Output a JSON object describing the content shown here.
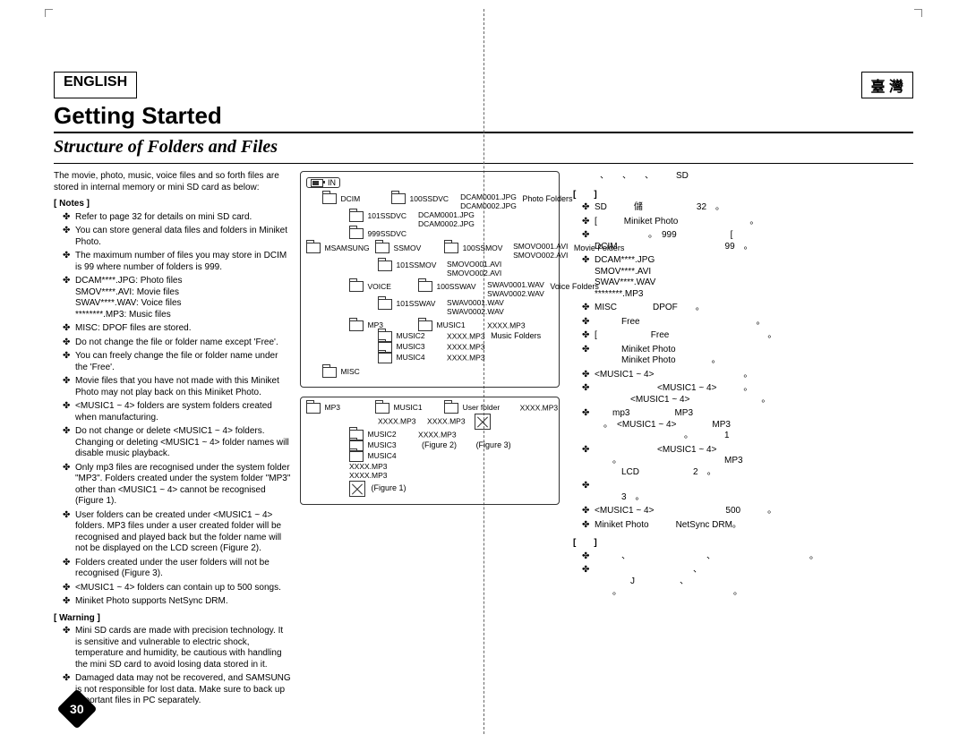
{
  "page_number": "30",
  "lang_left_label": "ENGLISH",
  "lang_right_label": "臺 灣",
  "title_en": "Getting Started",
  "subtitle_en": "Structure of Folders and Files",
  "intro_en": "The movie, photo, music, voice files and so forth files are stored in internal memory or mini SD card as below:",
  "notes_hdr": "Notes",
  "notes_en": [
    "Refer to page 32 for details on mini SD card.",
    "You can store general data files and folders in Miniket Photo.",
    "The maximum number of files you may store in DCIM is 99 where number of folders is 999.",
    "DCAM****.JPG: Photo files\nSMOV****.AVI: Movie files\nSWAV****.WAV: Voice files\n********.MP3: Music files",
    "MISC: DPOF files are stored.",
    "Do not change the file or folder name except 'Free'.",
    "You can freely change the file or folder name under the 'Free'.",
    "Movie files that you have not made with this Miniket Photo may not play back on this Miniket Photo.",
    "<MUSIC1 ~ 4> folders are system folders created when manufacturing.",
    "Do not change or delete <MUSIC1 ~ 4> folders. Changing or deleting <MUSIC1 ~ 4> folder names will disable music playback.",
    "Only mp3 files are recognised under the system folder \"MP3\". Folders created under the system folder \"MP3\" other than <MUSIC1 ~ 4> cannot be recognised (Figure 1).",
    "User folders can be created under <MUSIC1 ~ 4> folders. MP3 files under a user created folder will be recognised and played back but the folder name will not be displayed on the LCD screen (Figure 2).",
    "Folders created under the user folders will not be recognised (Figure 3).",
    "<MUSIC1 ~ 4> folders can contain up to 500 songs.",
    "Miniket Photo supports NetSync DRM."
  ],
  "warning_hdr": "Warning",
  "warnings_en": [
    "Mini SD cards are made with precision technology. It is sensitive and vulnerable to electric shock, temperature and humidity, be cautious with handling the mini SD card to avoid losing data stored in it.",
    "Damaged data may not be recovered, and SAMSUNG is not responsible for lost data. Make sure to back up important files in PC separately."
  ],
  "diagram": {
    "badge_text": "IN",
    "dcim": {
      "name": "DCIM",
      "subs": [
        "100SSDVC",
        "101SSDVC",
        "999SSDVC"
      ],
      "files": [
        "DCAM0001.JPG",
        "DCAM0002.JPG",
        "DCAM0001.JPG",
        "DCAM0002.JPG"
      ],
      "category": "Photo Folders"
    },
    "msamsung": "MSAMSUNG",
    "ssmov": {
      "name": "SSMOV",
      "subs": [
        "100SSMOV",
        "101SSMOV"
      ],
      "files": [
        "SMOVO001.AVI",
        "SMOVO002.AVI",
        "SMOVO001.AVI",
        "SMOVO002.AVI"
      ],
      "category": "Movie Folders"
    },
    "voice": {
      "name": "VOICE",
      "subs": [
        "100SSWAV",
        "101SSWAV"
      ],
      "files": [
        "SWAV0001.WAV",
        "SWAV0002.WAV",
        "SWAV0001.WAV",
        "SWAV0002.WAV"
      ],
      "category": "Voice Folders"
    },
    "mp3": {
      "name": "MP3",
      "subs": [
        "MUSIC1",
        "MUSIC2",
        "MUSIC3",
        "MUSIC4"
      ],
      "file_generic": "XXXX.MP3",
      "category": "Music Folders"
    },
    "misc": "MISC"
  },
  "diagram2": {
    "mp3": "MP3",
    "music": [
      "MUSIC1",
      "MUSIC2",
      "MUSIC3",
      "MUSIC4"
    ],
    "user_folder": "User folder",
    "file_generic": "XXXX.MP3",
    "fig1": "(Figure 1)",
    "fig2": "(Figure 2)",
    "fig3": "(Figure 3)"
  },
  "zh": {
    "intro_suffix": "SD",
    "notes_hdr_left": "[",
    "notes_hdr_right": "]",
    "items": [
      "SD　　　儲　　　　　　32　。",
      "[　　　Miniket Photo　　　　　　　　。",
      "　　　　　　。　999　　　　　　[\nDCIM　　　　　　　　　　　　99　。",
      "DCAM****.JPG\nSMOV****.AVI\nSWAV****.WAV\n********.MP3",
      "MISC　　　　DPOF　　。",
      "　　　Free　　　　　　　　　　　　　。",
      "[　　　　　　Free　　　　　　　　　　　。",
      "　　　Miniket Photo　　　　　　　　\n　　　Miniket Photo　　　　。",
      "<MUSIC1 ~ 4>　　　　　　　　　　。",
      "　　　　　　　<MUSIC1 ~ 4>　　　。\n　　　　<MUSIC1 ~ 4>　　　　　　　　。",
      "　　mp3　　　　　MP3　　　　　　　\n　。　<MUSIC1 ~ 4>　　　　MP3　　\n　　　　　　　　　　。　　　　1",
      "　　　　　　　<MUSIC1 ~ 4>　　　\n　　。　　　　　　　　　　　　MP3\n　　　LCD　　　　　　2　。",
      "　　　　　　　　　　　　　　　　\n　　　3　。",
      "<MUSIC1 ~ 4>　　　　　　　　500　　　。",
      "Miniket Photo　　　NetSync DRM。"
    ],
    "warn_hdr_left": "[",
    "warn_hdr_right": "]",
    "warns": [
      "　　　、　　　　　　　　　、　　　　　　　　　　　。",
      "　　　　　　　　　　　、　　　　\n　　　　J　　　　　、　　　　　\n　　。　　　　　　　　　　　　　。"
    ]
  }
}
